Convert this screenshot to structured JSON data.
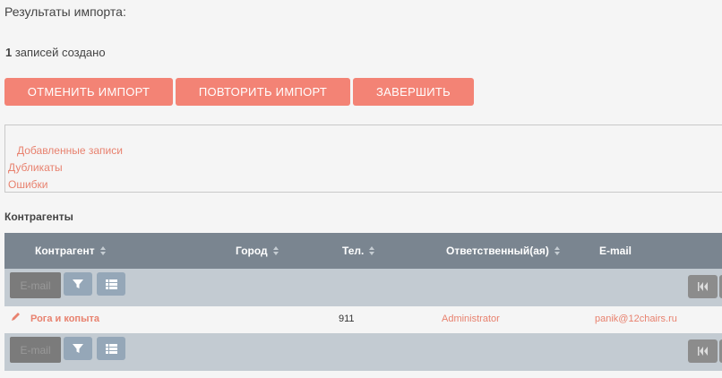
{
  "page": {
    "heading": "Результаты импорта:",
    "created_count": "1",
    "created_text": " записей создано"
  },
  "buttons": {
    "cancel": "ОТМЕНИТЬ ИМПОРТ",
    "repeat": "ПОВТОРИТЬ ИМПОРТ",
    "finish": "ЗАВЕРШИТЬ"
  },
  "tabs": {
    "added": "Добавленные записи",
    "duplicates": "Дубликаты",
    "errors": "Ошибки"
  },
  "section_title": "Контрагенты",
  "table": {
    "columns": [
      "Контрагент",
      "Город",
      "Тел.",
      "Ответственный(ая)",
      "E-mail"
    ],
    "toolbar_field": "E-mail",
    "rows": [
      {
        "name": "Рога и копыта",
        "city": "",
        "phone": "911",
        "responsible": "Administrator",
        "email": "panik@12chairs.ru"
      }
    ]
  },
  "icons": {
    "edit": "pencil-icon",
    "filter": "filter-icon",
    "columns": "list-icon",
    "first_page": "first-page-icon"
  },
  "colors": {
    "accent": "#f38375",
    "header": "#7a8590",
    "toolbar": "#c3cbd2"
  }
}
